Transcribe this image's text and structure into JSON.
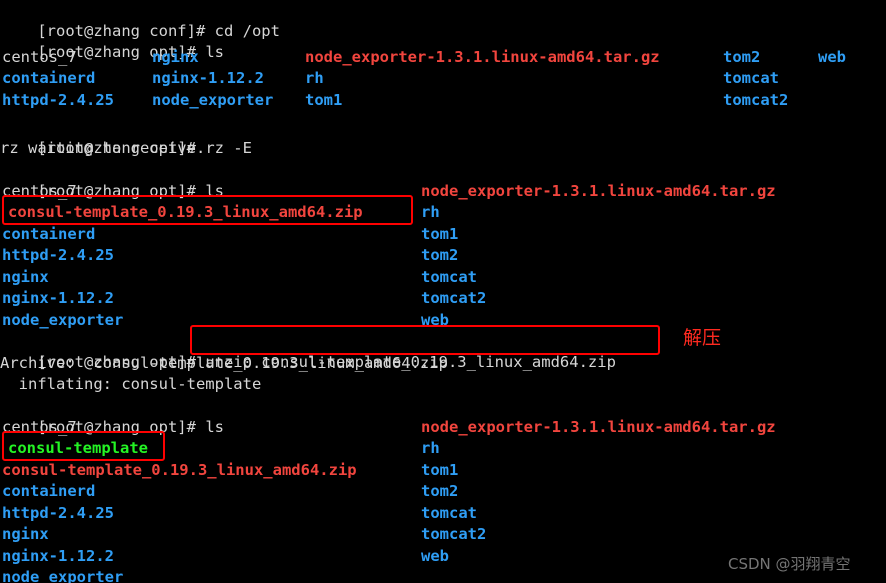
{
  "terminal": {
    "prompt_conf": "[root@zhang conf]# ",
    "prompt_opt": "[root@zhang opt]# ",
    "commands": {
      "cd_opt": "cd /opt",
      "ls": "ls",
      "rz": "rz -E",
      "unzip": "unzip consul-template_0.19.3_linux_amd64.zip"
    },
    "messages": {
      "rz_waiting": "rz waiting to receive.",
      "archive_label": "Archive:  consul-template_0.19.3_linux_amd64.zip",
      "inflating_label": "  inflating: consul-template"
    },
    "listing1": {
      "col1": [
        "centos_7",
        "containerd",
        "httpd-2.4.25"
      ],
      "col2": [
        "nginx",
        "nginx-1.12.2",
        "node_exporter"
      ],
      "col3": [
        "node_exporter-1.3.1.linux-amd64.tar.gz",
        "rh",
        "tom1"
      ],
      "col4": [
        "tom2",
        "tomcat",
        "tomcat2"
      ],
      "col5": [
        "web"
      ]
    },
    "listing2": {
      "col1": [
        "centos_7",
        "consul-template_0.19.3_linux_amd64.zip",
        "containerd",
        "httpd-2.4.25",
        "nginx",
        "nginx-1.12.2",
        "node_exporter"
      ],
      "col2": [
        "node_exporter-1.3.1.linux-amd64.tar.gz",
        "rh",
        "tom1",
        "tom2",
        "tomcat",
        "tomcat2",
        "web"
      ]
    },
    "listing3": {
      "col1": [
        "centos_7",
        "consul-template",
        "consul-template_0.19.3_linux_amd64.zip",
        "containerd",
        "httpd-2.4.25",
        "nginx",
        "nginx-1.12.2",
        "node_exporter"
      ],
      "col2": [
        "node_exporter-1.3.1.linux-amd64.tar.gz",
        "rh",
        "tom1",
        "tom2",
        "tomcat",
        "tomcat2",
        "web"
      ]
    }
  },
  "annotations": {
    "unzip_note": "解压",
    "box_color": "#ff0000"
  },
  "watermark": {
    "text": "CSDN @羽翔青空"
  },
  "colors": {
    "background": "#000000",
    "text": "#d6d6d6",
    "directory": "#2f9ef5",
    "archive": "#f1453e",
    "executable": "#24f424",
    "annotation": "#ff0000"
  }
}
